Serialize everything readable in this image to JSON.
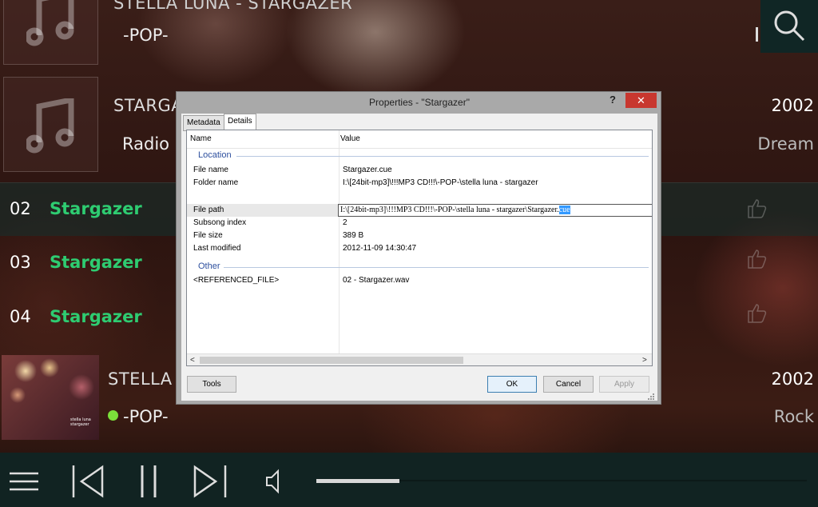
{
  "albums": [
    {
      "title": "STELLA LUNA - STARGAZER",
      "subtitle": "-POP-"
    },
    {
      "title": "STARGA",
      "subtitle": "Radio",
      "year": "2002",
      "genre": "Dream"
    },
    {
      "title": "STELLA L",
      "subtitle": "-POP-",
      "year": "2002",
      "genre": "Rock",
      "cover_text": "stella luna\nstargazer"
    }
  ],
  "tracks": [
    {
      "number": "02",
      "name": "Stargazer"
    },
    {
      "number": "03",
      "name": "Stargazer"
    },
    {
      "number": "04",
      "name": "Stargazer"
    }
  ],
  "dialog": {
    "title": "Properties - \"Stargazer\"",
    "help": "?",
    "close": "✕",
    "tabs": [
      "Metadata",
      "Details"
    ],
    "active_tab": "Details",
    "columns": {
      "name": "Name",
      "value": "Value"
    },
    "groups": {
      "location": "Location",
      "other": "Other"
    },
    "rows": [
      {
        "name": "File name",
        "value": "Stargazer.cue"
      },
      {
        "name": "Folder name",
        "value": "I:\\[24bit-mp3]\\!!!MP3 CD!!!\\-POP-\\stella luna - stargazer"
      },
      {
        "name": "File path",
        "value_prefix": "I:\\[24bit-mp3]\\!!!MP3 CD!!!\\-POP-\\stella luna - stargazer\\Stargazer.",
        "value_selected": "cue"
      },
      {
        "name": "Subsong index",
        "value": "2"
      },
      {
        "name": "File size",
        "value": "389 B"
      },
      {
        "name": "Last modified",
        "value": "2012-11-09 14:30:47"
      }
    ],
    "other_rows": [
      {
        "name": "<REFERENCED_FILE>",
        "value": "02 - Stargazer.wav"
      }
    ],
    "buttons": {
      "tools": "Tools",
      "ok": "OK",
      "cancel": "Cancel",
      "apply": "Apply"
    }
  },
  "player": {
    "progress": 0.17,
    "icons": [
      "menu-icon",
      "previous-icon",
      "pause-icon",
      "next-icon",
      "volume-icon",
      "search-icon"
    ]
  },
  "colors": {
    "track_green": "#2ecc71",
    "accent_blue": "#2d4f9e",
    "close_red": "#c8372f"
  }
}
